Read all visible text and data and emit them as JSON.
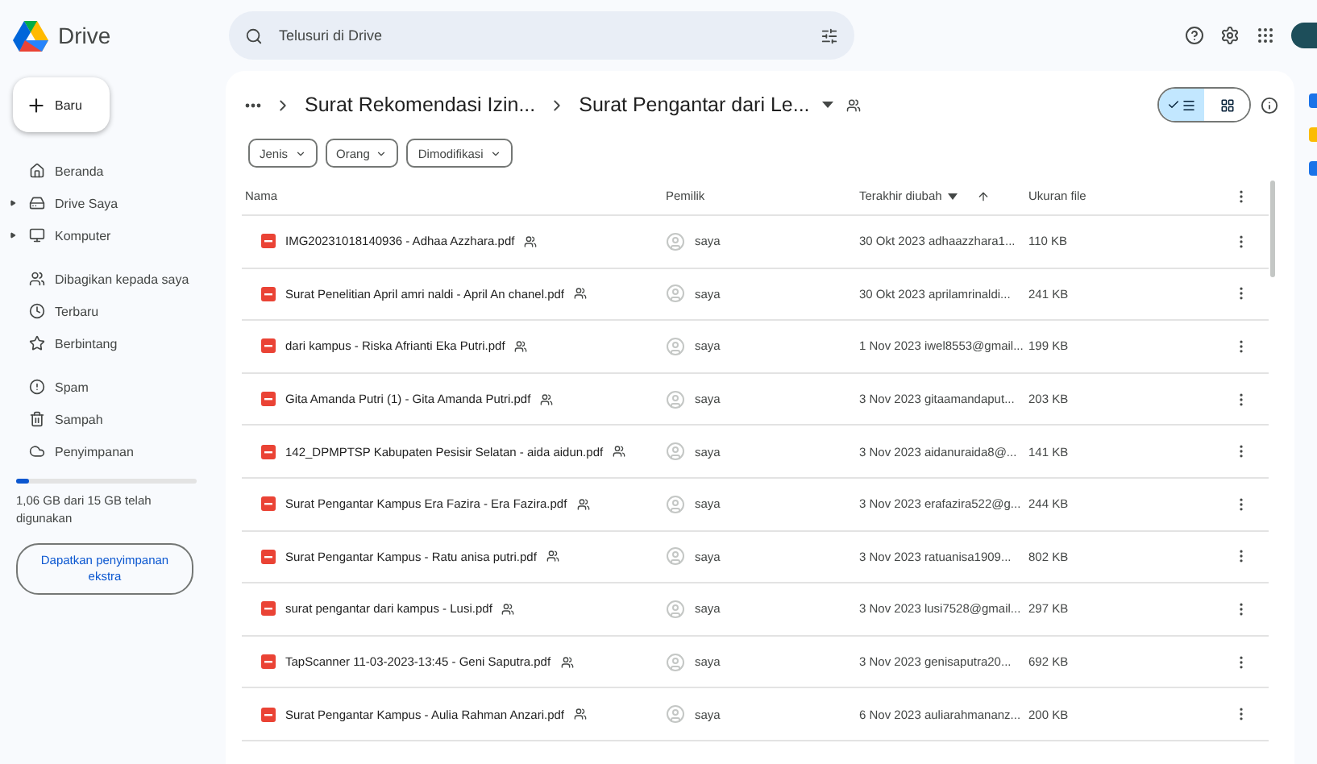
{
  "app": {
    "name": "Drive"
  },
  "search": {
    "placeholder": "Telusuri di Drive"
  },
  "new_button": "Baru",
  "sidebar": {
    "groups": [
      [
        {
          "label": "Beranda",
          "kind": "home",
          "expandable": false
        },
        {
          "label": "Drive Saya",
          "kind": "drive",
          "expandable": true
        },
        {
          "label": "Komputer",
          "kind": "computer",
          "expandable": true
        }
      ],
      [
        {
          "label": "Dibagikan kepada saya",
          "kind": "shared",
          "expandable": false
        },
        {
          "label": "Terbaru",
          "kind": "recent",
          "expandable": false
        },
        {
          "label": "Berbintang",
          "kind": "star",
          "expandable": false
        }
      ],
      [
        {
          "label": "Spam",
          "kind": "spam",
          "expandable": false
        },
        {
          "label": "Sampah",
          "kind": "trash",
          "expandable": false
        },
        {
          "label": "Penyimpanan",
          "kind": "storage",
          "expandable": false
        }
      ]
    ]
  },
  "storage": {
    "level": 0.07,
    "text": "1,06 GB dari 15 GB telah digunakan",
    "button": "Dapatkan penyimpanan ekstra"
  },
  "breadcrumb": [
    "Surat Rekomendasi Izin...",
    "Surat Pengantar dari Le..."
  ],
  "view_toggle": [
    {
      "kind": "list",
      "selected": true
    },
    {
      "kind": "grid",
      "selected": false
    }
  ],
  "filters": [
    "Jenis",
    "Orang",
    "Dimodifikasi"
  ],
  "table": {
    "columns": [
      {
        "label": "Nama",
        "sorted": false
      },
      {
        "label": "Pemilik",
        "sorted": false
      },
      {
        "label": "Terakhir diubah",
        "sorted": true
      },
      {
        "label": "Ukuran file",
        "sorted": false
      }
    ],
    "rows": [
      {
        "name": "IMG20231018140936 - Adhaa Azzhara.pdf",
        "shared": true,
        "owner": "saya",
        "modified": "30 Okt 2023 adhaazzhara1...",
        "size": "110 KB"
      },
      {
        "name": "Surat Penelitian April amri naldi - April An chanel.pdf",
        "shared": true,
        "owner": "saya",
        "modified": "30 Okt 2023 aprilamrinaldi...",
        "size": "241 KB"
      },
      {
        "name": "dari kampus - Riska Afrianti Eka Putri.pdf",
        "shared": true,
        "owner": "saya",
        "modified": "1 Nov 2023 iwel8553@gmail...",
        "size": "199 KB"
      },
      {
        "name": "Gita Amanda Putri (1) - Gita Amanda Putri.pdf",
        "shared": true,
        "owner": "saya",
        "modified": "3 Nov 2023 gitaamandaput...",
        "size": "203 KB"
      },
      {
        "name": "142_DPMPTSP Kabupaten Pesisir Selatan - aida aidun.pdf",
        "shared": true,
        "owner": "saya",
        "modified": "3 Nov 2023 aidanuraida8@...",
        "size": "141 KB"
      },
      {
        "name": "Surat Pengantar Kampus Era Fazira - Era Fazira.pdf",
        "shared": true,
        "owner": "saya",
        "modified": "3 Nov 2023 erafazira522@g...",
        "size": "244 KB"
      },
      {
        "name": "Surat Pengantar Kampus - Ratu anisa putri.pdf",
        "shared": true,
        "owner": "saya",
        "modified": "3 Nov 2023 ratuanisa1909...",
        "size": "802 KB"
      },
      {
        "name": "surat pengantar dari kampus - Lusi.pdf",
        "shared": true,
        "owner": "saya",
        "modified": "3 Nov 2023 lusi7528@gmail...",
        "size": "297 KB"
      },
      {
        "name": "TapScanner 11-03-2023-13:45 - Geni Saputra.pdf",
        "shared": true,
        "owner": "saya",
        "modified": "3 Nov 2023 genisaputra20...",
        "size": "692 KB"
      },
      {
        "name": "Surat Pengantar Kampus - Aulia Rahman Anzari.pdf",
        "shared": true,
        "owner": "saya",
        "modified": "6 Nov 2023 auliarahmananz...",
        "size": "200 KB"
      }
    ]
  }
}
